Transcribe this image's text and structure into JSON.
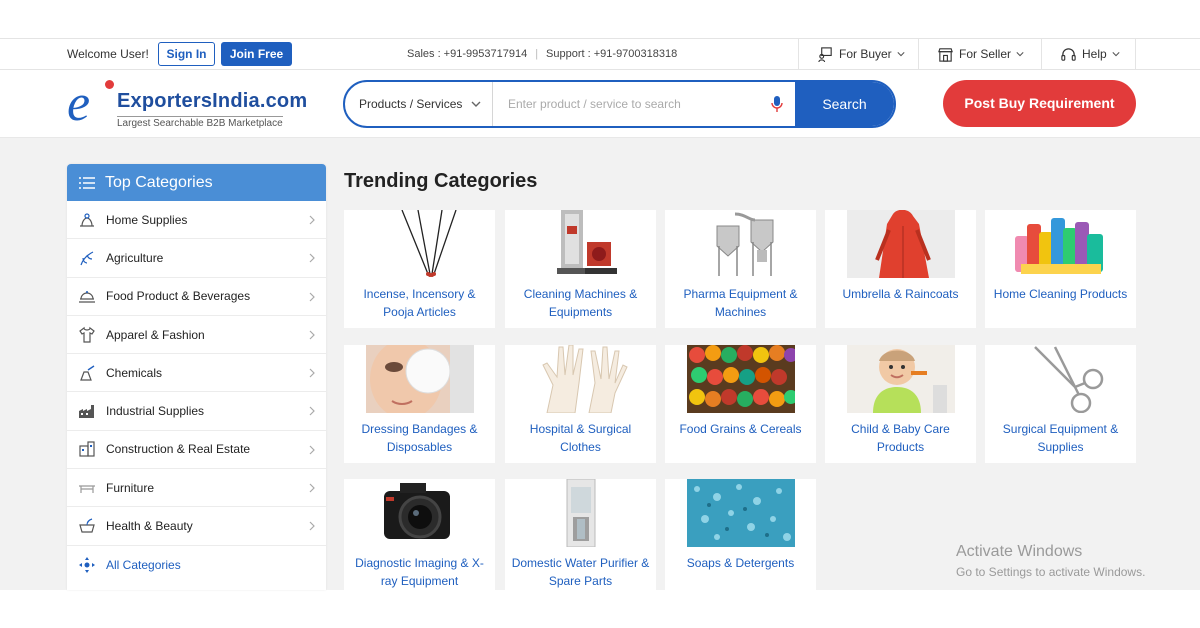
{
  "topbar": {
    "welcome": "Welcome User!",
    "signin": "Sign In",
    "joinfree": "Join Free",
    "sales": "Sales : +91-9953717914",
    "support": "Support : +91-9700318318",
    "for_buyer": "For Buyer",
    "for_seller": "For Seller",
    "help": "Help"
  },
  "header": {
    "logo_name": "ExportersIndia.com",
    "logo_tagline": "Largest Searchable B2B Marketplace",
    "search_category": "Products / Services",
    "search_placeholder": "Enter product / service to search",
    "search_button": "Search",
    "post_button": "Post Buy Requirement"
  },
  "sidebar": {
    "title": "Top Categories",
    "items": [
      {
        "label": "Home Supplies",
        "icon": "home-supplies-icon"
      },
      {
        "label": "Agriculture",
        "icon": "agriculture-icon"
      },
      {
        "label": "Food Product & Beverages",
        "icon": "food-icon"
      },
      {
        "label": "Apparel & Fashion",
        "icon": "apparel-icon"
      },
      {
        "label": "Chemicals",
        "icon": "chemicals-icon"
      },
      {
        "label": "Industrial Supplies",
        "icon": "industrial-icon"
      },
      {
        "label": "Construction & Real Estate",
        "icon": "construction-icon"
      },
      {
        "label": "Furniture",
        "icon": "furniture-icon"
      },
      {
        "label": "Health & Beauty",
        "icon": "health-beauty-icon"
      }
    ],
    "all_categories": "All Categories"
  },
  "trending": {
    "title": "Trending Categories",
    "cards": [
      {
        "label": "Incense, Incensory & Pooja Articles"
      },
      {
        "label": "Cleaning Machines & Equipments"
      },
      {
        "label": "Pharma Equipment & Machines"
      },
      {
        "label": "Umbrella & Raincoats"
      },
      {
        "label": "Home Cleaning Products"
      },
      {
        "label": "Dressing Bandages & Disposables"
      },
      {
        "label": "Hospital & Surgical Clothes"
      },
      {
        "label": "Food Grains & Cereals"
      },
      {
        "label": "Child & Baby Care Products"
      },
      {
        "label": "Surgical Equipment & Supplies"
      },
      {
        "label": "Diagnostic Imaging & X-ray Equipment"
      },
      {
        "label": "Domestic Water Purifier & Spare Parts"
      },
      {
        "label": "Soaps & Detergents"
      }
    ]
  },
  "watermark": {
    "line1": "Activate Windows",
    "line2": "Go to Settings to activate Windows."
  },
  "colors": {
    "primary_blue": "#1f5fbf",
    "sidebar_head": "#4a8ed6",
    "accent_red": "#e23b3b",
    "background": "#f2f2f2"
  }
}
